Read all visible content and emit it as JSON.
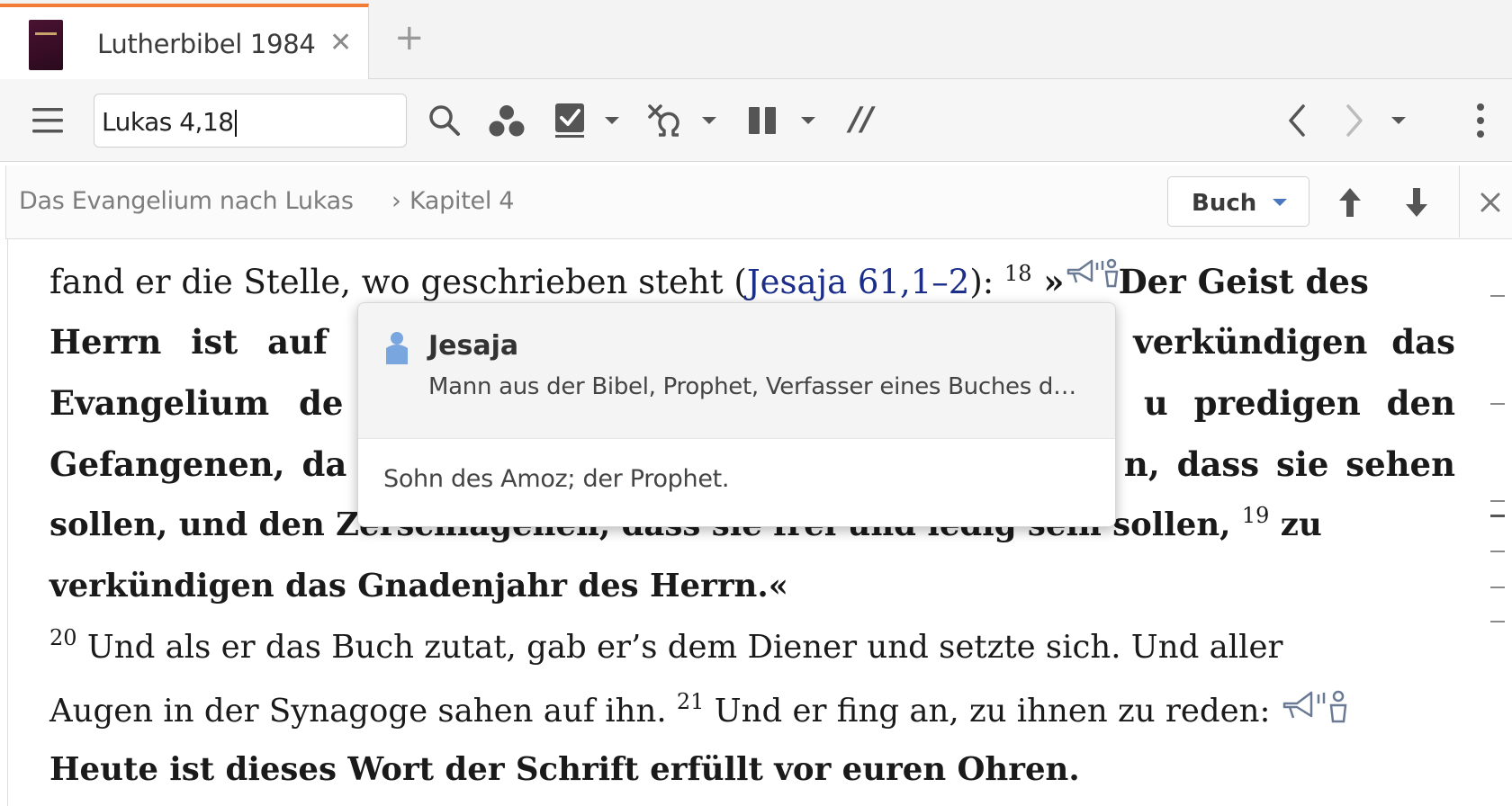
{
  "tab": {
    "title": "Lutherbibel 1984",
    "close": "✕",
    "add": "+"
  },
  "toolbar": {
    "search_value": "Lukas 4,18",
    "parallel_label": "//"
  },
  "breadcrumb": {
    "book": "Das Evangelium nach Lukas",
    "separator": "›",
    "chapter": "Kapitel 4"
  },
  "scope": {
    "label": "Buch"
  },
  "text": {
    "l1_a": "fand er die Stelle, wo geschrieben steht (",
    "l1_ref": "Jesaja 61,1–2",
    "l1_b": "): ",
    "v18": "18",
    "l1_quote": " »",
    "l1_bold": "Der Geist des",
    "l2_a": "Herrn ist auf",
    "l2_b": "verkündigen das",
    "l3_a": "Evangelium de",
    "l3_b": "u predigen den",
    "l4_a": "Gefangenen, da",
    "l4_b": "n, dass sie sehen",
    "l5": "sollen, und den Zerschlagenen, dass sie frei und ledig sein sollen,",
    "v19": "19",
    "l5_b": " zu",
    "l6": "verkündigen das Gnadenjahr des Herrn.«",
    "v20": "20",
    "l7": " Und als er das Buch zutat, gab er’s dem Diener und setzte sich. Und aller",
    "l8_a": "Augen in der Synagoge sahen auf ihn. ",
    "v21": "21",
    "l8_b": " Und er fing an, zu ihnen zu reden: ",
    "l9": "Heute ist dieses Wort der Schrift erfüllt vor euren Ohren."
  },
  "popup": {
    "title": "Jesaja",
    "description": "Mann aus der Bibel, Prophet, Verfasser eines Buches d…",
    "body": "Sohn des Amoz; der Prophet."
  },
  "icons": [
    "menu-icon",
    "search-icon",
    "people-icon",
    "checkbox-icon",
    "clause-icon",
    "columns-icon",
    "back-icon",
    "forward-icon",
    "overflow-icon",
    "arrow-up-icon",
    "arrow-down-icon",
    "close-icon",
    "speaker-icon",
    "person-icon"
  ],
  "colors": {
    "tab_accent": "#f07c36",
    "link": "#1b2f8a",
    "person_icon": "#7aa6e0"
  }
}
